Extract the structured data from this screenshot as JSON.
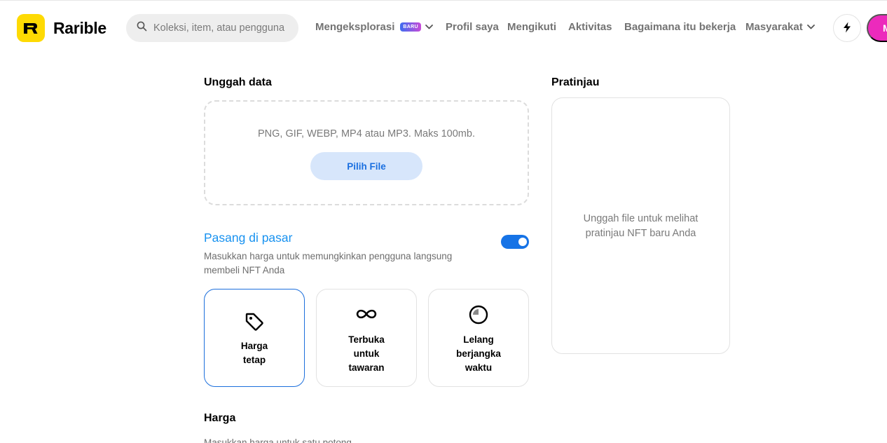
{
  "header": {
    "logo_text": "Rarible",
    "search": {
      "placeholder": "Koleksi, item, atau pengguna"
    },
    "nav": {
      "explore": "Mengeksplorasi",
      "explore_badge": "BARU",
      "profile": "Profil saya",
      "following": "Mengikuti",
      "activity": "Aktivitas",
      "how_it_works": "Bagaimana itu bekerja",
      "community": "Masyarakat"
    },
    "account_button": "M",
    "colors": {
      "logo_bg": "#FEDA03",
      "accent_pink": "#EC2ABC",
      "badge_gradient": [
        "#3e6df0",
        "#c84bd8"
      ]
    }
  },
  "upload": {
    "title": "Unggah data",
    "hint": "PNG, GIF, WEBP, MP4 atau MP3. Maks 100mb.",
    "button": "Pilih File"
  },
  "marketplace": {
    "title": "Pasang di pasar",
    "description": "Masukkan harga untuk memungkinkan pengguna langsung membeli NFT Anda",
    "toggle_on": true,
    "options": [
      {
        "icon": "tag-icon",
        "label": "Harga tetap",
        "selected": true
      },
      {
        "icon": "infinity-icon",
        "label": "Terbuka untuk tawaran",
        "selected": false
      },
      {
        "icon": "timer-icon",
        "label": "Lelang berjangka waktu",
        "selected": false
      }
    ]
  },
  "price": {
    "title": "Harga",
    "subtitle": "Masukkan harga untuk satu potong"
  },
  "preview": {
    "title": "Pratinjau",
    "placeholder": "Unggah file untuk melihat pratinjau NFT baru Anda"
  }
}
